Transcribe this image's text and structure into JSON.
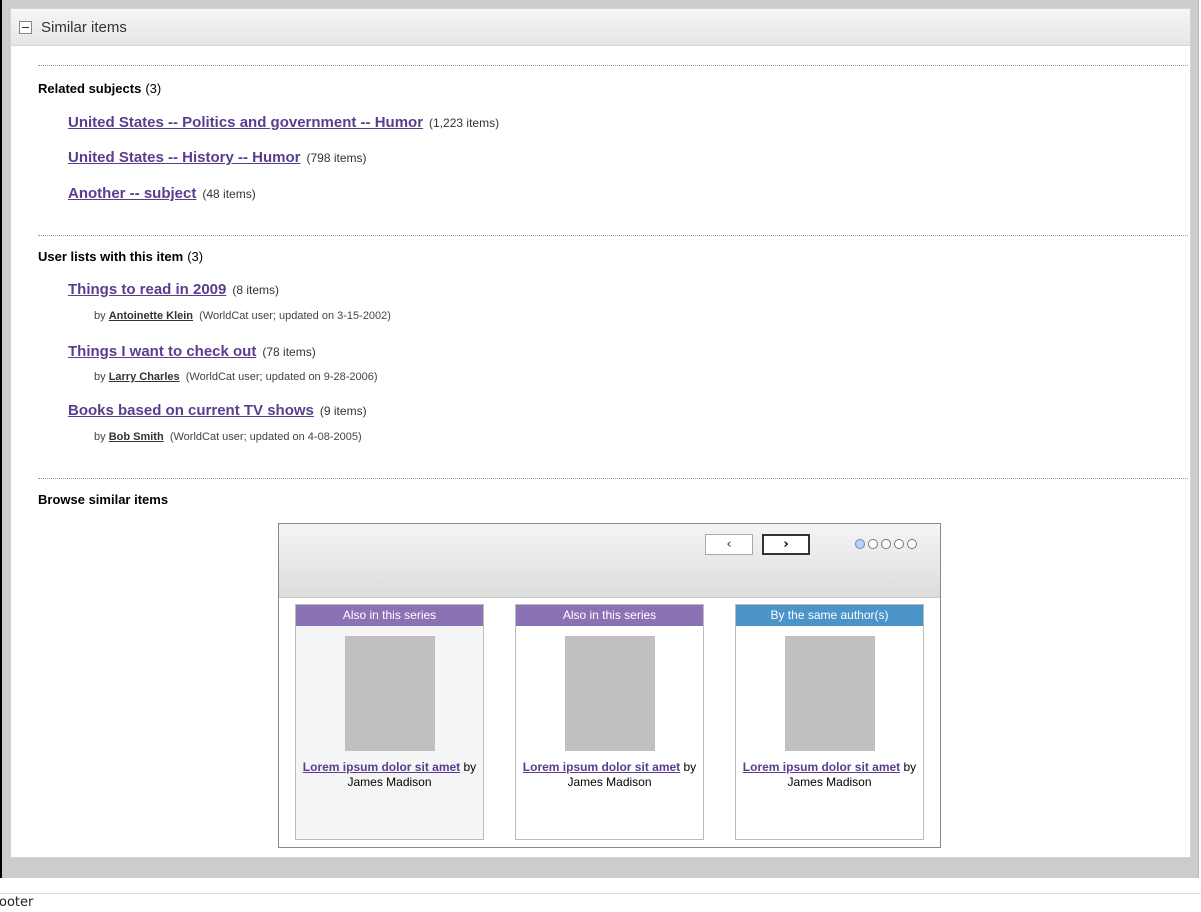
{
  "panel": {
    "title": "Similar items"
  },
  "related": {
    "heading": "Related subjects",
    "count": "(3)",
    "items": [
      {
        "label": "United States -- Politics and government -- Humor",
        "meta": "(1,223 items)"
      },
      {
        "label": "United States -- History -- Humor",
        "meta": "(798 items)"
      },
      {
        "label": "Another -- subject",
        "meta": "(48 items)"
      }
    ]
  },
  "lists": {
    "heading": "User lists with this item",
    "count": "(3)",
    "items": [
      {
        "label": "Things to read in 2009",
        "meta": "(8 items)",
        "by": "by",
        "user": "Antoinette Klein",
        "detail": "(WorldCat user; updated on 3-15-2002)"
      },
      {
        "label": "Things I want to check out",
        "meta": "(78 items)",
        "by": "by",
        "user": "Larry Charles",
        "detail": "(WorldCat user; updated on 9-28-2006)"
      },
      {
        "label": "Books based on current TV shows",
        "meta": "(9 items)",
        "by": "by",
        "user": "Bob Smith",
        "detail": "(WorldCat user; updated on 4-08-2005)"
      }
    ]
  },
  "browse": {
    "heading": "Browse similar items",
    "prev_icon": "‹",
    "next_icon": "›",
    "dots": 5,
    "active_dot": 1,
    "cards": [
      {
        "tag": "Also in this series",
        "tag_color": "#8b72b5",
        "title": "Lorem ipsum dolor sit amet",
        "author": "by James Madison"
      },
      {
        "tag": "Also in this series",
        "tag_color": "#8b72b5",
        "title": "Lorem ipsum dolor sit amet",
        "author": "by James Madison"
      },
      {
        "tag": "By the same author(s)",
        "tag_color": "#4a94c9",
        "title": "Lorem ipsum dolor sit amet",
        "author": "by James Madison"
      }
    ]
  },
  "footer": {
    "text": "Footer"
  },
  "colors": {
    "link": "#5a3d8f",
    "series_tag": "#8b72b5",
    "author_tag": "#4a94c9"
  }
}
